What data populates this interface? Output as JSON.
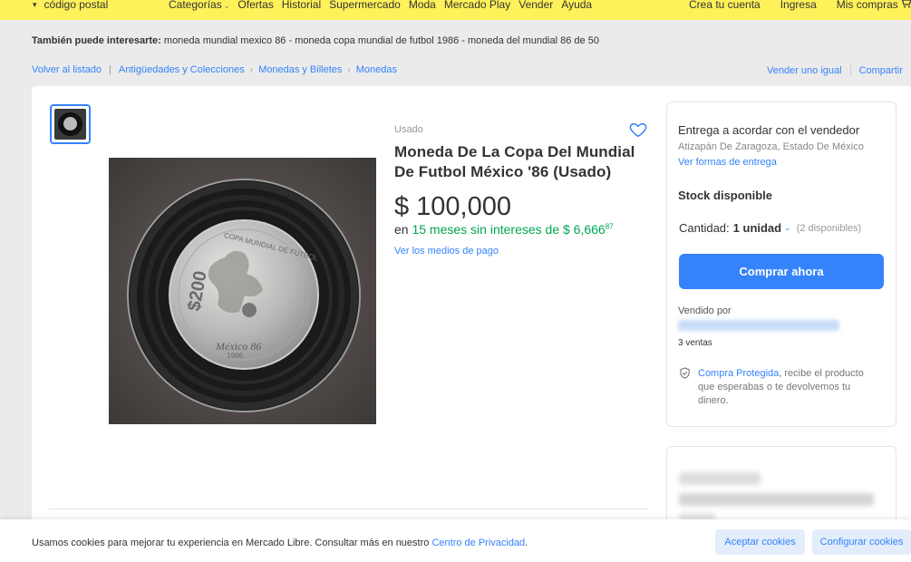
{
  "colors": {
    "header": "#fff159",
    "accent": "#3483fa",
    "green": "#00a650"
  },
  "topbar": {
    "location_icon": "location-pin-icon",
    "location_label": "código postal",
    "nav": [
      "Categorías",
      "Ofertas",
      "Historial",
      "Supermercado",
      "Moda",
      "Mercado Play",
      "Vender",
      "Ayuda"
    ],
    "nav_caret_icon": "chevron-down-icon",
    "account": [
      "Crea tu cuenta",
      "Ingresa",
      "Mis compras"
    ],
    "cart_icon": "cart-icon"
  },
  "also_interest": {
    "label": "También puede interesarte:",
    "items": "moneda mundial mexico 86 - moneda copa mundial de futbol 1986 - moneda del mundial 86 de 50"
  },
  "breadcrumb": {
    "back": "Volver al listado",
    "items": [
      "Antigüedades y Colecciones",
      "Monedas y Billetes",
      "Monedas"
    ]
  },
  "actions": {
    "sell_same": "Vender uno igual",
    "share": "Compartir"
  },
  "product": {
    "condition": "Usado",
    "title": "Moneda De La Copa Del Mundial De Futbol México '86 (Usado)",
    "currency": "$",
    "price": "100,000",
    "installments_prefix": "en",
    "installments": "15 meses sin intereses de $ 6,666",
    "installments_cents": "87",
    "payment_link": "Ver los medios de pago",
    "coin_text_top": "COPA MUNDIAL DE FUTBOL",
    "coin_denomination": "$200",
    "coin_text_bottom": "México 86",
    "coin_year": "1986"
  },
  "purchase": {
    "shipping_title": "Entrega a acordar con el vendedor",
    "shipping_location": "Atizapán De Zaragoza, Estado De México",
    "shipping_link": "Ver formas de entrega",
    "stock": "Stock disponible",
    "quantity_label": "Cantidad:",
    "quantity_value": "1 unidad",
    "quantity_available": "(2 disponibles)",
    "buy_button": "Comprar ahora",
    "sold_by": "Vendido por",
    "sales": "3 ventas",
    "protect_link": "Compra Protegida",
    "protect_text": ", recibe el producto que esperabas o te devolvemos tu dinero."
  },
  "cookies": {
    "message": "Usamos cookies para mejorar tu experiencia en Mercado Libre. Consultar más en nuestro",
    "link": "Centro de Privacidad",
    "end": ".",
    "accept": "Aceptar cookies",
    "configure": "Configurar cookies"
  }
}
